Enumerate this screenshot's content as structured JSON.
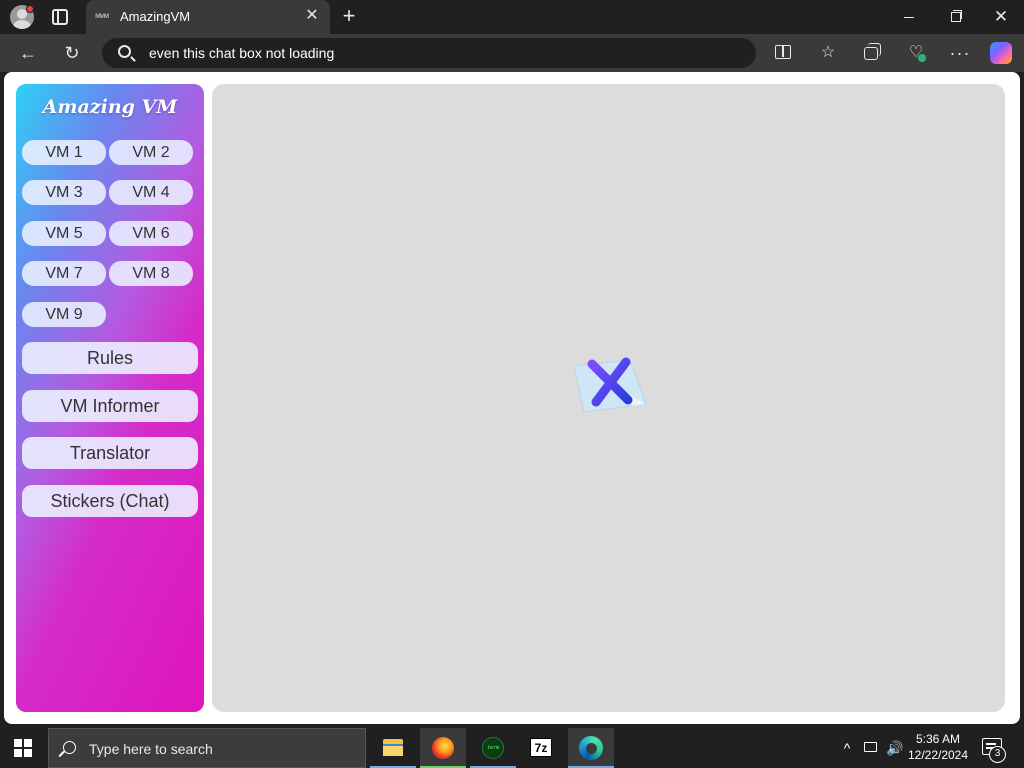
{
  "browser": {
    "tab_title": "AmazingVM",
    "tab_favicon": "ᴍᴠᴍ",
    "address": "even this chat box not loading",
    "close_tab_glyph": "✕",
    "new_tab_glyph": "+",
    "window_close_glyph": "✕",
    "back_glyph": "←",
    "reload_glyph": "↻",
    "favorites_glyph": "☆",
    "more_glyph": "···",
    "perf_glyph": "♡",
    "accent_colors": {
      "copilot": "#8c5cff",
      "status_green": "#2bb673"
    }
  },
  "page": {
    "logo": "Amazing VM",
    "vm_buttons": [
      "VM 1",
      "VM 2",
      "VM 3",
      "VM 4",
      "VM 5",
      "VM 6",
      "VM 7",
      "VM 8",
      "VM 9"
    ],
    "menu": [
      "Rules",
      "VM Informer",
      "Translator",
      "Stickers (Chat)"
    ],
    "content_bg": "#dcdcdc",
    "sidebar_gradient": [
      "#2ed0f5",
      "#b45ae0",
      "#df14bb"
    ]
  },
  "taskbar": {
    "search_placeholder": "Type here to search",
    "apps": [
      "file-explorer-icon",
      "firefox-icon",
      "terminal-app-icon",
      "7zip-icon",
      "edge-icon"
    ],
    "seven_zip_label": "7z",
    "terminal_label": "term",
    "chevron_glyph": "^",
    "volume_glyph": "🔊",
    "time": "5:36 AM",
    "date": "12/22/2024",
    "notification_count": "3"
  }
}
